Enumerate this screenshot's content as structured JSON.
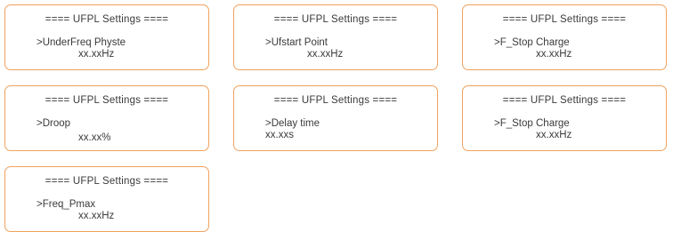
{
  "screens": [
    {
      "title": "==== UFPL Settings ====",
      "param": ">UnderFreq Physte",
      "value": "xx.xxHz"
    },
    {
      "title": "==== UFPL Settings ====",
      "param": ">Ufstart Point",
      "value": "xx.xxHz"
    },
    {
      "title": "==== UFPL Settings ====",
      "param": ">F_Stop Charge",
      "value": "xx.xxHz"
    },
    {
      "title": "==== UFPL Settings ====",
      "param": ">Droop",
      "value": "xx.xx%"
    },
    {
      "title": "==== UFPL Settings ====",
      "param": ">Delay time",
      "value": "xx.xxs"
    },
    {
      "title": "==== UFPL Settings ====",
      "param": ">F_Stop Charge",
      "value": "xx.xxHz"
    },
    {
      "title": "==== UFPL Settings ====",
      "param": ">Freq_Pmax",
      "value": "xx.xxHz"
    }
  ],
  "colors": {
    "border": "#f0a25c",
    "text": "#3a3a3a"
  }
}
